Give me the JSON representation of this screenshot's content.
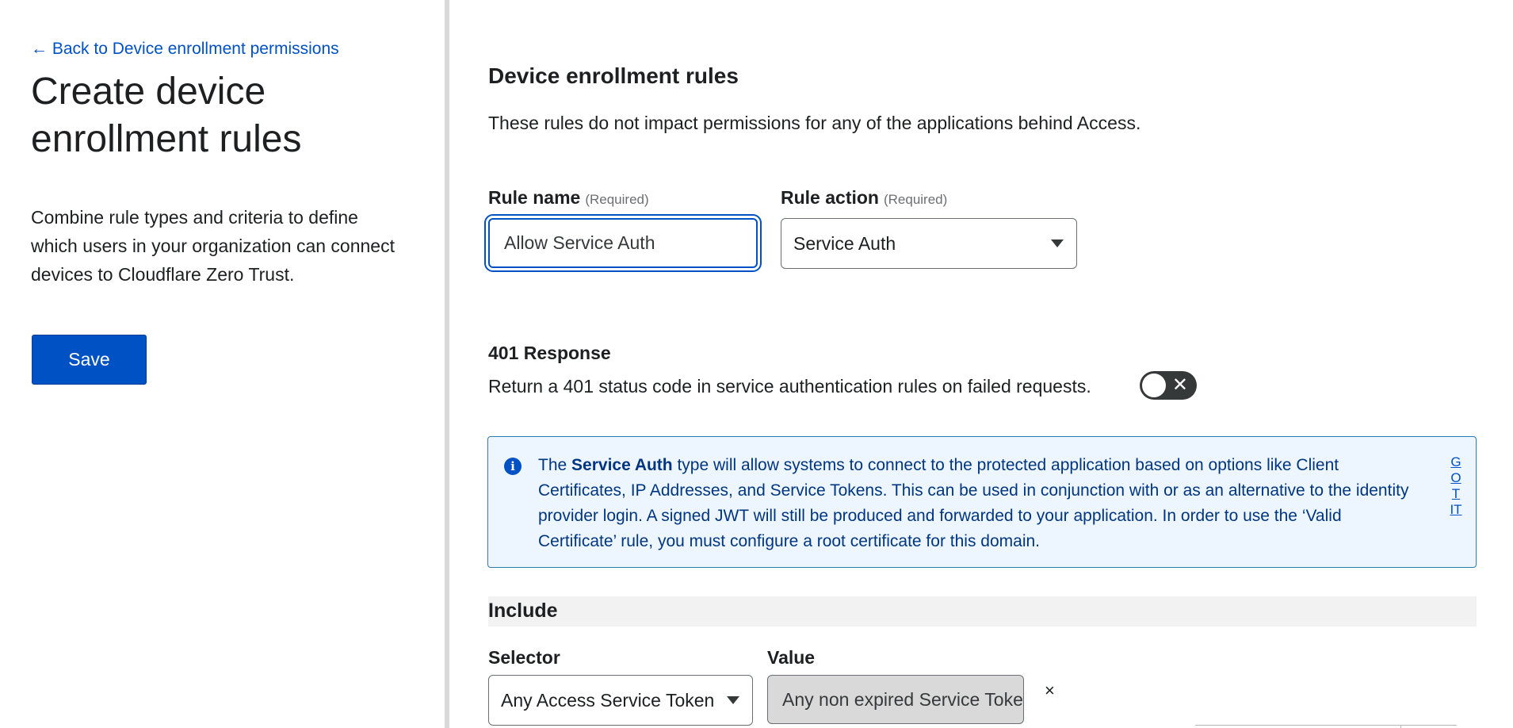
{
  "left_panel": {
    "back_link": "← Back to Device enrollment permissions",
    "title": "Create device enrollment rules",
    "description": "Combine rule types and criteria to define which users in your organization can connect devices to Cloudflare Zero Trust.",
    "save_label": "Save"
  },
  "main": {
    "section_title": "Device enrollment rules",
    "section_description": "These rules do not impact permissions for any of the applications behind Access.",
    "rule_name": {
      "label": "Rule name",
      "required": "(Required)",
      "value": "Allow Service Auth"
    },
    "rule_action": {
      "label": "Rule action",
      "required": "(Required)",
      "value": "Service Auth"
    },
    "response_401": {
      "title": "401 Response",
      "description": "Return a 401 status code in service authentication rules on failed requests.",
      "toggle_on": false
    },
    "info": {
      "prefix": "The ",
      "bold": "Service Auth",
      "text": " type will allow systems to connect to the protected application based on options like Client Certificates, IP Addresses, and Service Tokens. This can be used in conjunction with or as an alternative to the identity provider login. A signed JWT will still be produced and forwarded to your application. In order to use the ‘Valid Certificate’ rule, you must configure a root certificate for this domain.",
      "dismiss": "GOT IT"
    },
    "include": {
      "title": "Include",
      "selector_label": "Selector",
      "value_label": "Value",
      "selector_value": "Any Access Service Token",
      "value_text": "Any non expired Service Token will be matched",
      "remove": "×"
    }
  },
  "colors": {
    "accent": "#0051c3",
    "info_bg": "#edf5ff",
    "info_text": "#003681"
  }
}
